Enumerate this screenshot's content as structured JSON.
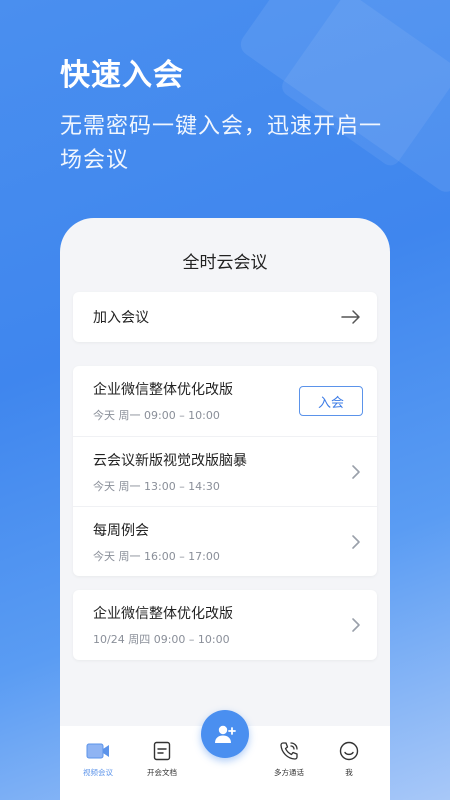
{
  "hero": {
    "title": "快速入会",
    "subtitle": "无需密码一键入会，迅速开启一场会议"
  },
  "app": {
    "title": "全时云会议",
    "join_label": "加入会议",
    "meetings_today": [
      {
        "title": "企业微信整体优化改版",
        "time": "今天 周一  09:00 – 10:00",
        "action": "入会"
      },
      {
        "title": "云会议新版视觉改版脑暴",
        "time": "今天 周一 13:00 – 14:30"
      },
      {
        "title": "每周例会",
        "time": "今天 周一 16:00 – 17:00"
      }
    ],
    "meetings_later": [
      {
        "title": "企业微信整体优化改版",
        "time": "10/24 周四 09:00 – 10:00"
      }
    ]
  },
  "tabs": [
    {
      "label": "视频会议",
      "icon": "video-camera-icon",
      "active": true
    },
    {
      "label": "开会文档",
      "icon": "document-icon"
    },
    {
      "label": "多方通话",
      "icon": "phone-call-icon"
    },
    {
      "label": "我",
      "icon": "smiley-icon"
    }
  ],
  "fab": {
    "icon": "add-person-icon"
  },
  "colors": {
    "accent": "#4a8ff0",
    "background": "#4a8fef",
    "card_bg": "#ffffff",
    "panel_bg": "#f4f5f8"
  }
}
